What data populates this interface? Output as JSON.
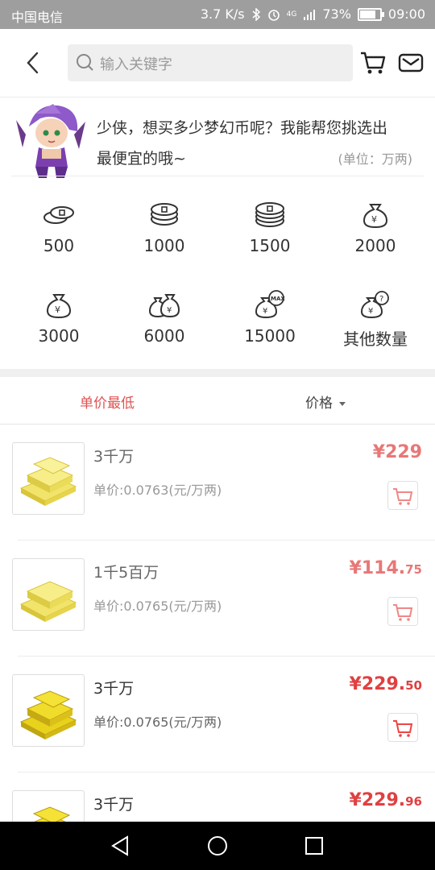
{
  "status": {
    "carrier": "中国电信",
    "speed": "3.7 K/s",
    "network": "4G",
    "battery": "73%",
    "time": "09:00"
  },
  "header": {
    "search_placeholder": "输入关键字"
  },
  "intro": {
    "line1": "少侠，想买多少梦幻币呢？我能帮您挑选出",
    "line2": "最便宜的哦~",
    "unit": "(单位：万两)"
  },
  "quantities": [
    "500",
    "1000",
    "1500",
    "2000",
    "3000",
    "6000",
    "15000",
    "其他数量"
  ],
  "quantity_icons": [
    "coin-stack-small-icon",
    "coin-stack-icon",
    "coin-stack-large-icon",
    "money-bag-icon",
    "money-bag-icon",
    "money-bags-icon",
    "money-bag-max-icon",
    "money-bag-question-icon"
  ],
  "sort": {
    "cheapest": "单价最低",
    "price": "价格"
  },
  "listings": [
    {
      "title": "3千万",
      "unit_price": "单价:0.0763(元/万两)",
      "price_int": "¥229",
      "price_dec": ""
    },
    {
      "title": "1千5百万",
      "unit_price": "单价:0.0765(元/万两)",
      "price_int": "¥114.",
      "price_dec": "75"
    },
    {
      "title": "3千万",
      "unit_price": "单价:0.0765(元/万两)",
      "price_int": "¥229.",
      "price_dec": "50"
    },
    {
      "title": "3千万",
      "unit_price": "",
      "price_int": "¥229.",
      "price_dec": "96"
    }
  ],
  "colors": {
    "accent": "#e05252",
    "price": "#e87777",
    "statusbar": "#9e9e9e",
    "navbar": "#000000"
  }
}
